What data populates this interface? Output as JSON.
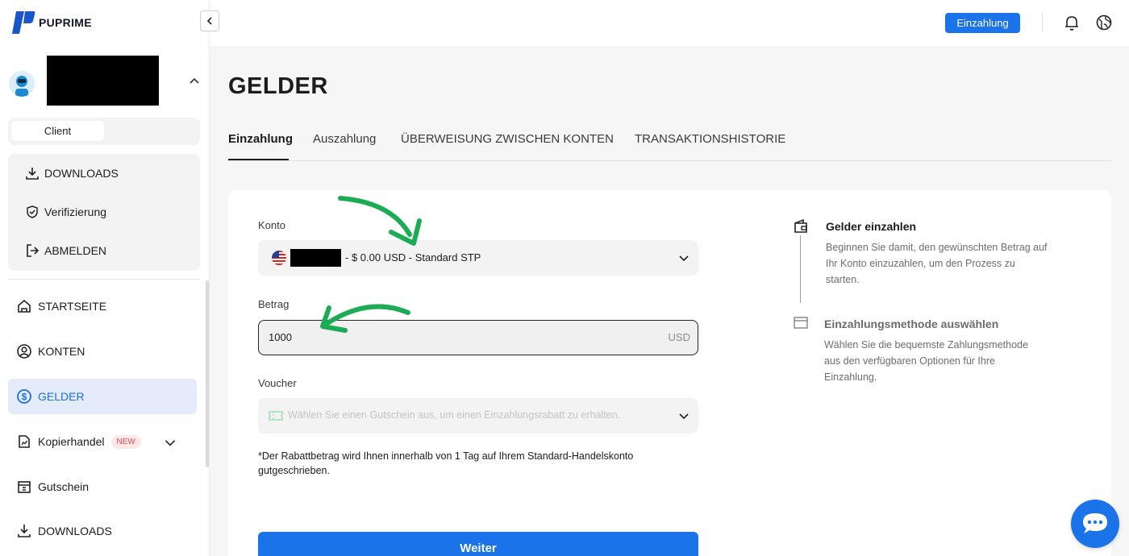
{
  "brand": {
    "name": "PUPRIME",
    "logo_color": "#1a56c8"
  },
  "sidebar": {
    "role": "Client",
    "account_menu": [
      {
        "label": "DOWNLOADS",
        "icon": "download-icon"
      },
      {
        "label": "Verifizierung",
        "icon": "shield-icon"
      },
      {
        "label": "ABMELDEN",
        "icon": "logout-icon"
      }
    ],
    "nav": [
      {
        "label": "STARTSEITE",
        "icon": "home-icon"
      },
      {
        "label": "KONTEN",
        "icon": "user-circle-icon"
      },
      {
        "label": "GELDER",
        "icon": "dollar-icon",
        "active": true
      },
      {
        "label": "Kopierhandel",
        "icon": "copy-trade-icon",
        "badge": "NEW"
      },
      {
        "label": "Gutschein",
        "icon": "voucher-icon"
      },
      {
        "label": "DOWNLOADS",
        "icon": "download-icon"
      }
    ]
  },
  "topbar": {
    "deposit_label": "Einzahlung",
    "accent": "#1a73e8"
  },
  "main": {
    "title": "GELDER",
    "tabs": [
      "Einzahlung",
      "Auszahlung",
      "ÜBERWEISUNG ZWISCHEN KONTEN",
      "TRANSAKTIONSHISTORIE"
    ],
    "form": {
      "account_label": "Konto",
      "account_value": "- $ 0.00 USD - Standard STP",
      "amount_label": "Betrag",
      "amount_value": "1000",
      "amount_unit": "USD",
      "voucher_label": "Voucher",
      "voucher_placeholder": "Wählen Sie einen Gutschein aus, um einen Einzahlungsrabatt zu erhalten.",
      "note": "*Der Rabattbetrag wird Ihnen innerhalb von 1 Tag auf Ihrem Standard-Handelskonto gutgeschrieben.",
      "submit_label": "Weiter"
    },
    "steps": [
      {
        "title": "Gelder einzahlen",
        "desc": "Beginnen Sie damit, den gewünschten Betrag auf Ihr Konto einzuzahlen, um den Prozess zu starten."
      },
      {
        "title": "Einzahlungsmethode auswählen",
        "desc": "Wählen Sie die bequemste Zahlungsmethode aus den verfügbaren Optionen für Ihre Einzahlung."
      }
    ],
    "annotation_color": "#1eab55"
  }
}
